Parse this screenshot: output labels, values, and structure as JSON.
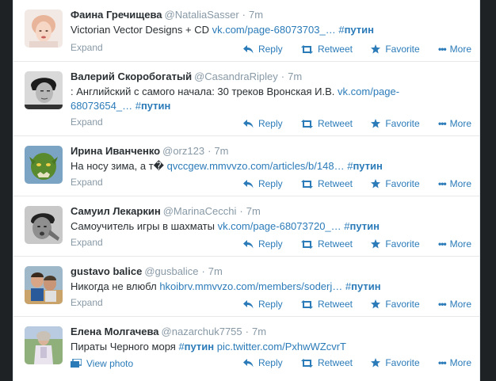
{
  "tweets": [
    {
      "fullname": "Фаина Гречищева",
      "username": "@NataliaSasser",
      "time": "7m",
      "text": "Victorian Vector Designs + CD ",
      "link": "vk.com/page-68073703_…",
      "link2": "",
      "hashtag_hash": "#",
      "hashtag": "путин",
      "expand": "Expand"
    },
    {
      "fullname": "Валерий Скоробогатый",
      "username": "@CasandraRipley",
      "time": "7m",
      "text": ": Английский с самого начала: 30 треков Вронская И.В. ",
      "link": "vk.com/page-",
      "link2": "68073654_…",
      "hashtag_hash": "#",
      "hashtag": "путин",
      "expand": "Expand"
    },
    {
      "fullname": "Ирина Иванченко",
      "username": "@orz123",
      "time": "7m",
      "text": "На носу зима, а т� ",
      "link": "qvccgew.mmvvzo.com/articles/b/148…",
      "link2": "",
      "hashtag_hash": "#",
      "hashtag": "путин",
      "expand": "Expand"
    },
    {
      "fullname": "Самуил Лекаркин",
      "username": "@MarinaCecchi",
      "time": "7m",
      "text": "Самоучитель игры в шахматы ",
      "link": "vk.com/page-68073720_…",
      "link2": "",
      "hashtag_hash": "#",
      "hashtag": "путин",
      "expand": "Expand"
    },
    {
      "fullname": "gustavo balice",
      "username": "@gusbalice",
      "time": "7m",
      "text": "Никогда не влюбл ",
      "link": "hkoibrv.mmvvzo.com/members/soderj…",
      "link2": "",
      "hashtag_hash": "#",
      "hashtag": "путин",
      "expand": "Expand"
    },
    {
      "fullname": "Елена Молгачева",
      "username": "@nazarchuk7755",
      "time": "7m",
      "text": "Пираты Черного моря ",
      "link": "",
      "link2": "",
      "hashtag_hash": "#",
      "hashtag": "путин",
      "link_after": "pic.twitter.com/PxhwWZcvrT",
      "expand": "View photo"
    }
  ],
  "actions": {
    "reply": "Reply",
    "retweet": "Retweet",
    "favorite": "Favorite",
    "more": "More"
  },
  "time_separator": "·",
  "colors": {
    "link": "#2b7bb9",
    "name": "#292f33",
    "meta": "#8899a6",
    "background_outside": "#1f2224"
  },
  "icons": [
    "reply-icon",
    "retweet-icon",
    "favorite-icon",
    "more-icon",
    "photo-icon"
  ]
}
